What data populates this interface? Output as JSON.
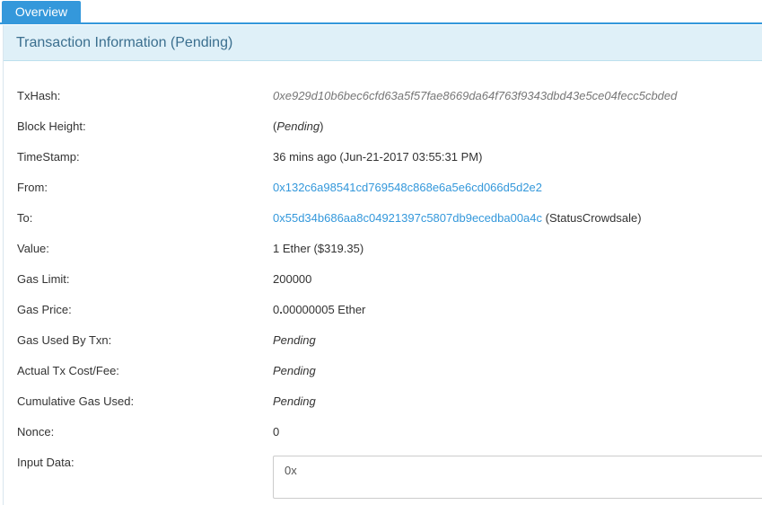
{
  "tabs": {
    "overview": "Overview"
  },
  "panel": {
    "title": "Transaction Information (Pending)"
  },
  "fields": {
    "txhash": {
      "label": "TxHash:",
      "value": "0xe929d10b6bec6cfd63a5f57fae8669da64f763f9343dbd43e5ce04fecc5cbded"
    },
    "block_height": {
      "label": "Block Height:",
      "open": "(",
      "value": "Pending",
      "close": ")"
    },
    "timestamp": {
      "label": "TimeStamp:",
      "value": "36 mins ago (Jun-21-2017 03:55:31 PM)"
    },
    "from": {
      "label": "From:",
      "value": "0x132c6a98541cd769548c868e6a5e6cd066d5d2e2"
    },
    "to": {
      "label": "To:",
      "value": "0x55d34b686aa8c04921397c5807db9ecedba00a4c",
      "contract_name": "(StatusCrowdsale)"
    },
    "value": {
      "label": "Value:",
      "value": "1 Ether ($319.35)"
    },
    "gas_limit": {
      "label": "Gas Limit:",
      "value": "200000"
    },
    "gas_price": {
      "label": "Gas Price:",
      "value_prefix": "0",
      "value_bold": ".",
      "value_rest": "00000005 Ether"
    },
    "gas_used": {
      "label": "Gas Used By Txn:",
      "value": "Pending"
    },
    "tx_cost": {
      "label": "Actual Tx Cost/Fee:",
      "value": "Pending"
    },
    "cumulative_gas": {
      "label": "Cumulative Gas Used:",
      "value": "Pending"
    },
    "nonce": {
      "label": "Nonce:",
      "value": "0"
    },
    "input_data": {
      "label": "Input Data:",
      "value": "0x"
    }
  },
  "colors": {
    "accent": "#3498db",
    "header_bg": "#dff0f8",
    "header_text": "#3b6f8f"
  }
}
